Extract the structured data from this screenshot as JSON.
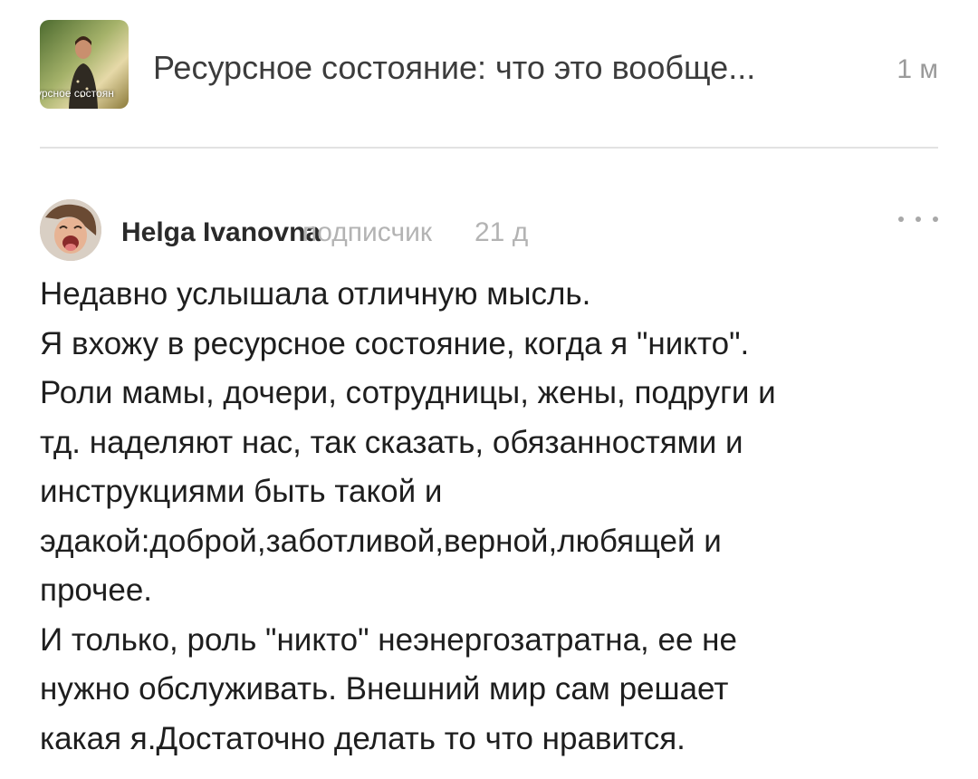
{
  "article": {
    "thumbnail_caption": "урсное состоян",
    "title": "Ресурсное состояние: что это вообще...",
    "time": "1 м"
  },
  "comment": {
    "author": "Helga Ivanovna",
    "role": "подписчик",
    "time": "21 д",
    "menu_icon": "more-dots-icon",
    "lines": [
      "Недавно услышала отличную мысль.",
      "Я вхожу в ресурсное состояние, когда я \"никто\".",
      "Роли мамы, дочери, сотрудницы, жены, подруги и",
      "тд. наделяют нас, так сказать, обязанностями и",
      "инструкциями быть такой и",
      "эдакой:доброй,заботливой,верной,любящей и",
      "прочее.",
      "И только, роль \"никто\" неэнергозатратна, ее не",
      "нужно обслуживать. Внешний мир сам решает",
      "какая я.Достаточно делать то что нравится."
    ]
  }
}
